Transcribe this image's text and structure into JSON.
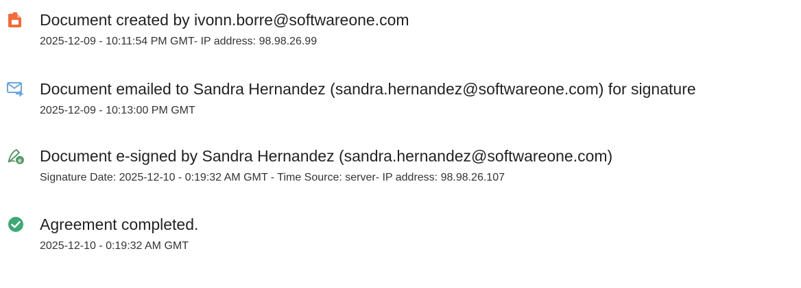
{
  "colors": {
    "created_icon": "#f26a3d",
    "emailed_icon": "#6aa6dc",
    "signed_icon": "#5a9a6a",
    "completed_icon": "#3ea876"
  },
  "events": [
    {
      "icon": "document-created-icon",
      "title": "Document created by ivonn.borre@softwareone.com",
      "detail": "2025-12-09 - 10:11:54 PM GMT- IP address: 98.98.26.99"
    },
    {
      "icon": "envelope-forward-icon",
      "title": "Document emailed to Sandra Hernandez (sandra.hernandez@softwareone.com) for signature",
      "detail": "2025-12-09 - 10:13:00 PM GMT"
    },
    {
      "icon": "pen-signature-icon",
      "title": "Document e-signed by Sandra Hernandez (sandra.hernandez@softwareone.com)",
      "detail": "Signature Date: 2025-12-10 - 0:19:32 AM GMT - Time Source: server- IP address: 98.98.26.107"
    },
    {
      "icon": "check-circle-icon",
      "title": "Agreement completed.",
      "detail": "2025-12-10 - 0:19:32 AM GMT"
    }
  ]
}
